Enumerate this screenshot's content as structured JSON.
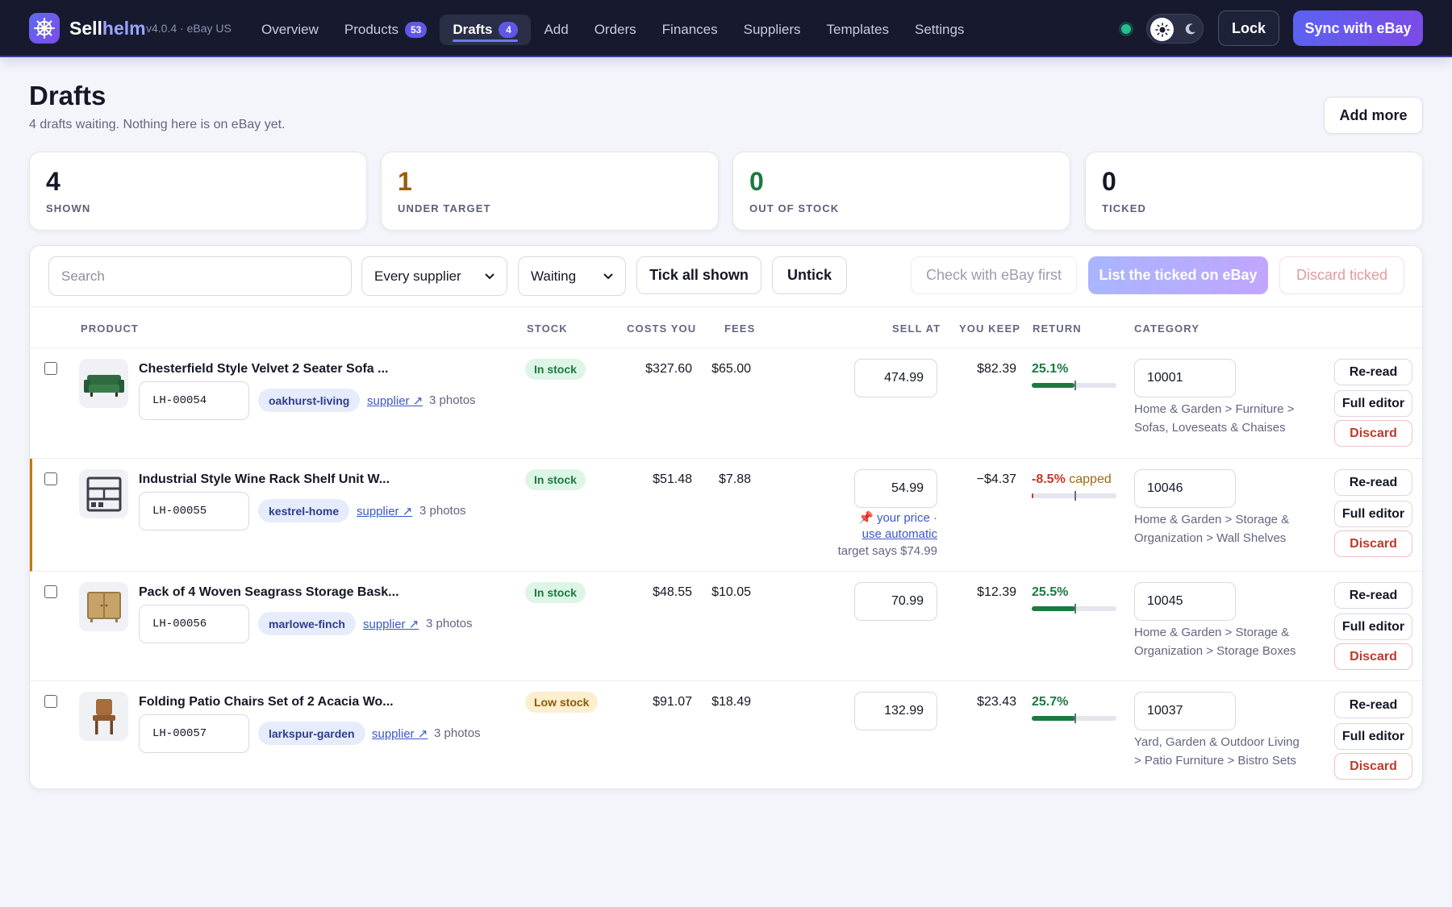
{
  "app": {
    "brand_a": "Sell",
    "brand_b": "helm",
    "version": "v4.0.4 · eBay US",
    "lock_label": "Lock",
    "sync_label": "Sync with eBay"
  },
  "nav": [
    {
      "label": "Overview"
    },
    {
      "label": "Products",
      "badge": "53"
    },
    {
      "label": "Drafts",
      "badge": "4",
      "active": true
    },
    {
      "label": "Add"
    },
    {
      "label": "Orders"
    },
    {
      "label": "Finances"
    },
    {
      "label": "Suppliers"
    },
    {
      "label": "Templates"
    },
    {
      "label": "Settings"
    }
  ],
  "page": {
    "title": "Drafts",
    "subtitle": "4 drafts waiting. Nothing here is on eBay yet.",
    "add_more_label": "Add more"
  },
  "stats": [
    {
      "value": "4",
      "label": "SHOWN",
      "color": "#151826"
    },
    {
      "value": "1",
      "label": "UNDER TARGET",
      "color": "#9c5d0a"
    },
    {
      "value": "0",
      "label": "OUT OF STOCK",
      "color": "#1b7a40"
    },
    {
      "value": "0",
      "label": "TICKED",
      "color": "#151826"
    }
  ],
  "toolbar": {
    "search_placeholder": "Search",
    "supplier_filter": "Every supplier",
    "status_filter": "Waiting",
    "tick_all": "Tick all shown",
    "untick": "Untick",
    "check_ebay": "Check with eBay first",
    "list_ticked": "List the ticked on eBay",
    "discard_ticked": "Discard ticked"
  },
  "columns": {
    "product": "PRODUCT",
    "stock": "STOCK",
    "costs": "COSTS YOU",
    "fees": "FEES",
    "sell": "SELL AT",
    "keep": "YOU KEEP",
    "return": "RETURN",
    "category": "CATEGORY"
  },
  "rows": [
    {
      "title": "Chesterfield Style Velvet 2 Seater Sofa ...",
      "sku": "LH-00054",
      "supplier": "oakhurst-living",
      "supplier_link": "supplier ↗",
      "photos": "3 photos",
      "stock": "In stock",
      "stock_level": "in",
      "costs": "$327.60",
      "fees": "$65.00",
      "sell": "474.99",
      "keep": "$82.39",
      "return_pct": "25.1%",
      "return_fraction": 0.5,
      "category_id": "10001",
      "category_path": "Home & Garden > Furniture > Sofas, Loveseats & Chaises",
      "thumb": "sofa-icon"
    },
    {
      "title": "Industrial Style Wine Rack Shelf Unit W...",
      "sku": "LH-00055",
      "supplier": "kestrel-home",
      "supplier_link": "supplier ↗",
      "photos": "3 photos",
      "stock": "In stock",
      "stock_level": "in",
      "costs": "$51.48",
      "fees": "$7.88",
      "sell": "54.99",
      "keep": "−$4.37",
      "return_pct": "-8.5%",
      "return_note": "capped",
      "return_fraction": 0.02,
      "category_id": "10046",
      "category_path": "Home & Garden > Storage & Organization > Wall Shelves",
      "price_hint_a": "📌",
      "price_hint_b": "your price",
      "price_hint_c": "·",
      "price_hint_link": "use automatic",
      "target_hint": "target says $74.99",
      "thumb": "shelf-icon"
    },
    {
      "title": "Pack of 4 Woven Seagrass Storage Bask...",
      "sku": "LH-00056",
      "supplier": "marlowe-finch",
      "supplier_link": "supplier ↗",
      "photos": "3 photos",
      "stock": "In stock",
      "stock_level": "in",
      "costs": "$48.55",
      "fees": "$10.05",
      "sell": "70.99",
      "keep": "$12.39",
      "return_pct": "25.5%",
      "return_fraction": 0.51,
      "category_id": "10045",
      "category_path": "Home & Garden > Storage & Organization > Storage Boxes",
      "thumb": "cabinet-icon"
    },
    {
      "title": "Folding Patio Chairs Set of 2 Acacia Wo...",
      "sku": "LH-00057",
      "supplier": "larkspur-garden",
      "supplier_link": "supplier ↗",
      "photos": "3 photos",
      "stock": "Low stock",
      "stock_level": "low",
      "costs": "$91.07",
      "fees": "$18.49",
      "sell": "132.99",
      "keep": "$23.43",
      "return_pct": "25.7%",
      "return_fraction": 0.51,
      "category_id": "10037",
      "category_path": "Yard, Garden & Outdoor Living > Patio Furniture > Bistro Sets",
      "thumb": "chair-icon"
    }
  ],
  "row_actions": {
    "reread": "Re-read",
    "full_editor": "Full editor",
    "discard": "Discard"
  }
}
